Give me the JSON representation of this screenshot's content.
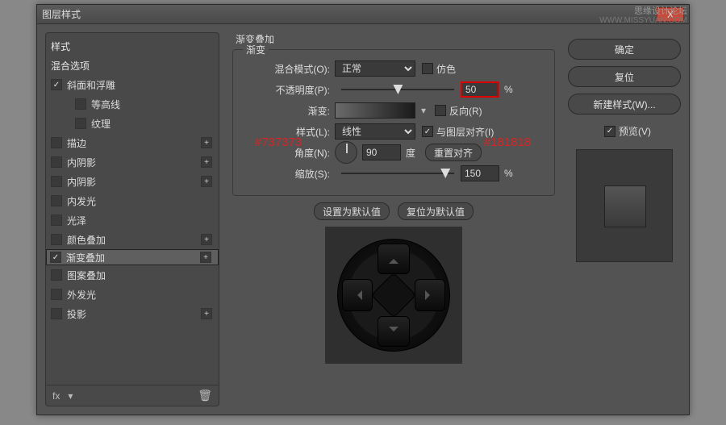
{
  "watermark1": "思缘设计论坛",
  "watermark2": "WWW.MISSYUAN.COM",
  "window": {
    "title": "图层样式"
  },
  "close_icon": "X",
  "left": {
    "header_style": "样式",
    "header_blend": "混合选项",
    "items": [
      {
        "label": "斜面和浮雕",
        "checked": true,
        "plus": false,
        "sub": false
      },
      {
        "label": "等高线",
        "checked": false,
        "plus": false,
        "sub": true
      },
      {
        "label": "纹理",
        "checked": false,
        "plus": false,
        "sub": true
      },
      {
        "label": "描边",
        "checked": false,
        "plus": true,
        "sub": false
      },
      {
        "label": "内阴影",
        "checked": false,
        "plus": true,
        "sub": false
      },
      {
        "label": "内阴影",
        "checked": false,
        "plus": true,
        "sub": false
      },
      {
        "label": "内发光",
        "checked": false,
        "plus": false,
        "sub": false
      },
      {
        "label": "光泽",
        "checked": false,
        "plus": false,
        "sub": false
      },
      {
        "label": "颜色叠加",
        "checked": false,
        "plus": true,
        "sub": false
      },
      {
        "label": "渐变叠加",
        "checked": true,
        "plus": true,
        "sub": false,
        "selected": true
      },
      {
        "label": "图案叠加",
        "checked": false,
        "plus": false,
        "sub": false
      },
      {
        "label": "外发光",
        "checked": false,
        "plus": false,
        "sub": false
      },
      {
        "label": "投影",
        "checked": false,
        "plus": true,
        "sub": false
      }
    ],
    "fx": "fx"
  },
  "center": {
    "title": "渐变叠加",
    "legend": "渐变",
    "blend_mode_label": "混合模式(O):",
    "blend_mode_value": "正常",
    "dither": "仿色",
    "opacity_label": "不透明度(P):",
    "opacity_value": "50",
    "pct": "%",
    "gradient_label": "渐变:",
    "reverse": "反向(R)",
    "style_label": "样式(L):",
    "style_value": "线性",
    "align": "与图层对齐(I)",
    "angle_label": "角度(N):",
    "angle_value": "90",
    "deg": "度",
    "reset_align": "重置对齐",
    "scale_label": "缩放(S):",
    "scale_value": "150",
    "set_default": "设置为默认值",
    "reset_default": "复位为默认值"
  },
  "right": {
    "ok": "确定",
    "cancel": "复位",
    "new_style": "新建样式(W)...",
    "preview": "预览(V)"
  },
  "annotations": {
    "color1": "#737373",
    "color2": "#181818"
  }
}
